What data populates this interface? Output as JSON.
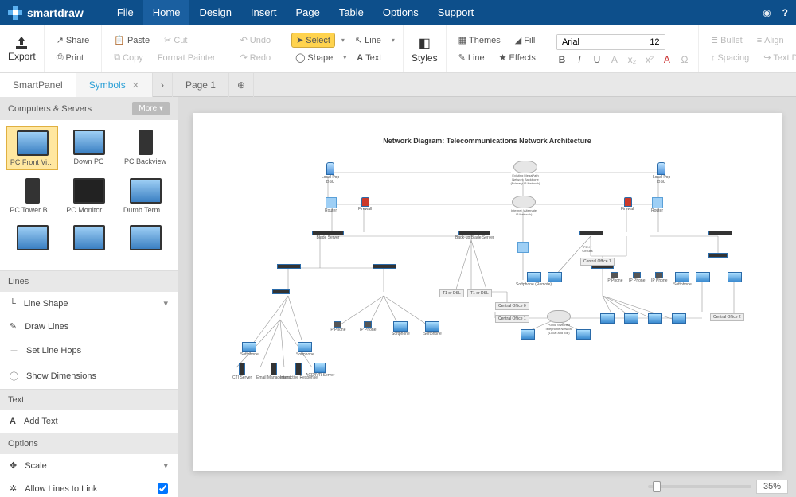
{
  "app": {
    "name": "smartdraw"
  },
  "menu": {
    "items": [
      "File",
      "Home",
      "Design",
      "Insert",
      "Page",
      "Table",
      "Options",
      "Support"
    ],
    "active": "Home"
  },
  "ribbon": {
    "export": "Export",
    "share": "Share",
    "print": "Print",
    "paste": "Paste",
    "cut": "Cut",
    "copy": "Copy",
    "format_painter": "Format Painter",
    "undo": "Undo",
    "redo": "Redo",
    "select": "Select",
    "shape": "Shape",
    "line": "Line",
    "text": "Text",
    "styles": "Styles",
    "themes": "Themes",
    "fill": "Fill",
    "line2": "Line",
    "effects": "Effects",
    "font_name": "Arial",
    "font_size": "12",
    "bullet": "Bullet",
    "align": "Align",
    "spacing": "Spacing",
    "text_direction": "Text Direction"
  },
  "tabs": {
    "smartpanel": "SmartPanel",
    "symbols": "Symbols",
    "page1": "Page 1"
  },
  "sidebar": {
    "category": "Computers & Servers",
    "more": "More ▾",
    "symbols": [
      "PC Front Vi…",
      "Down PC",
      "PC Backview",
      "PC Tower B…",
      "PC Monitor …",
      "Dumb Term…"
    ],
    "lines_head": "Lines",
    "line_shape": "Line Shape",
    "draw_lines": "Draw Lines",
    "set_line_hops": "Set Line Hops",
    "show_dimensions": "Show Dimensions",
    "text_head": "Text",
    "add_text": "Add Text",
    "options_head": "Options",
    "scale": "Scale",
    "allow_lines": "Allow Lines to Link"
  },
  "diagram": {
    "title": "Network Diagram: Telecommunications Network Architecture",
    "cloud1": "Existing MegaPath Network Backbone (Primary IP Network)",
    "cloud2": "Internet (Alternate IP Network)",
    "cloud3": "Public Switched Telephone Network (Local and Toll)",
    "pop_l": "Local Pop",
    "pop_r": "Local Pop",
    "dsu": "DSU",
    "router": "Router",
    "firewall": "Firewall",
    "blade": "Blade Server",
    "backup": "Back-up Blade Server",
    "softphone": "Softphone",
    "ipphone": "IP Phone",
    "remote": "Softphone (Remote)",
    "pbx": "PBX / Circuits",
    "co0": "Central Office 0",
    "co1": "Central Office 1",
    "co2": "Central Office 2",
    "t1": "T1 or DSL",
    "cti": "CTI Server",
    "email": "Email Management",
    "ivr": "Interactive Response",
    "acd": "ACD/IVR Server"
  },
  "zoom": {
    "pct": "35%"
  }
}
